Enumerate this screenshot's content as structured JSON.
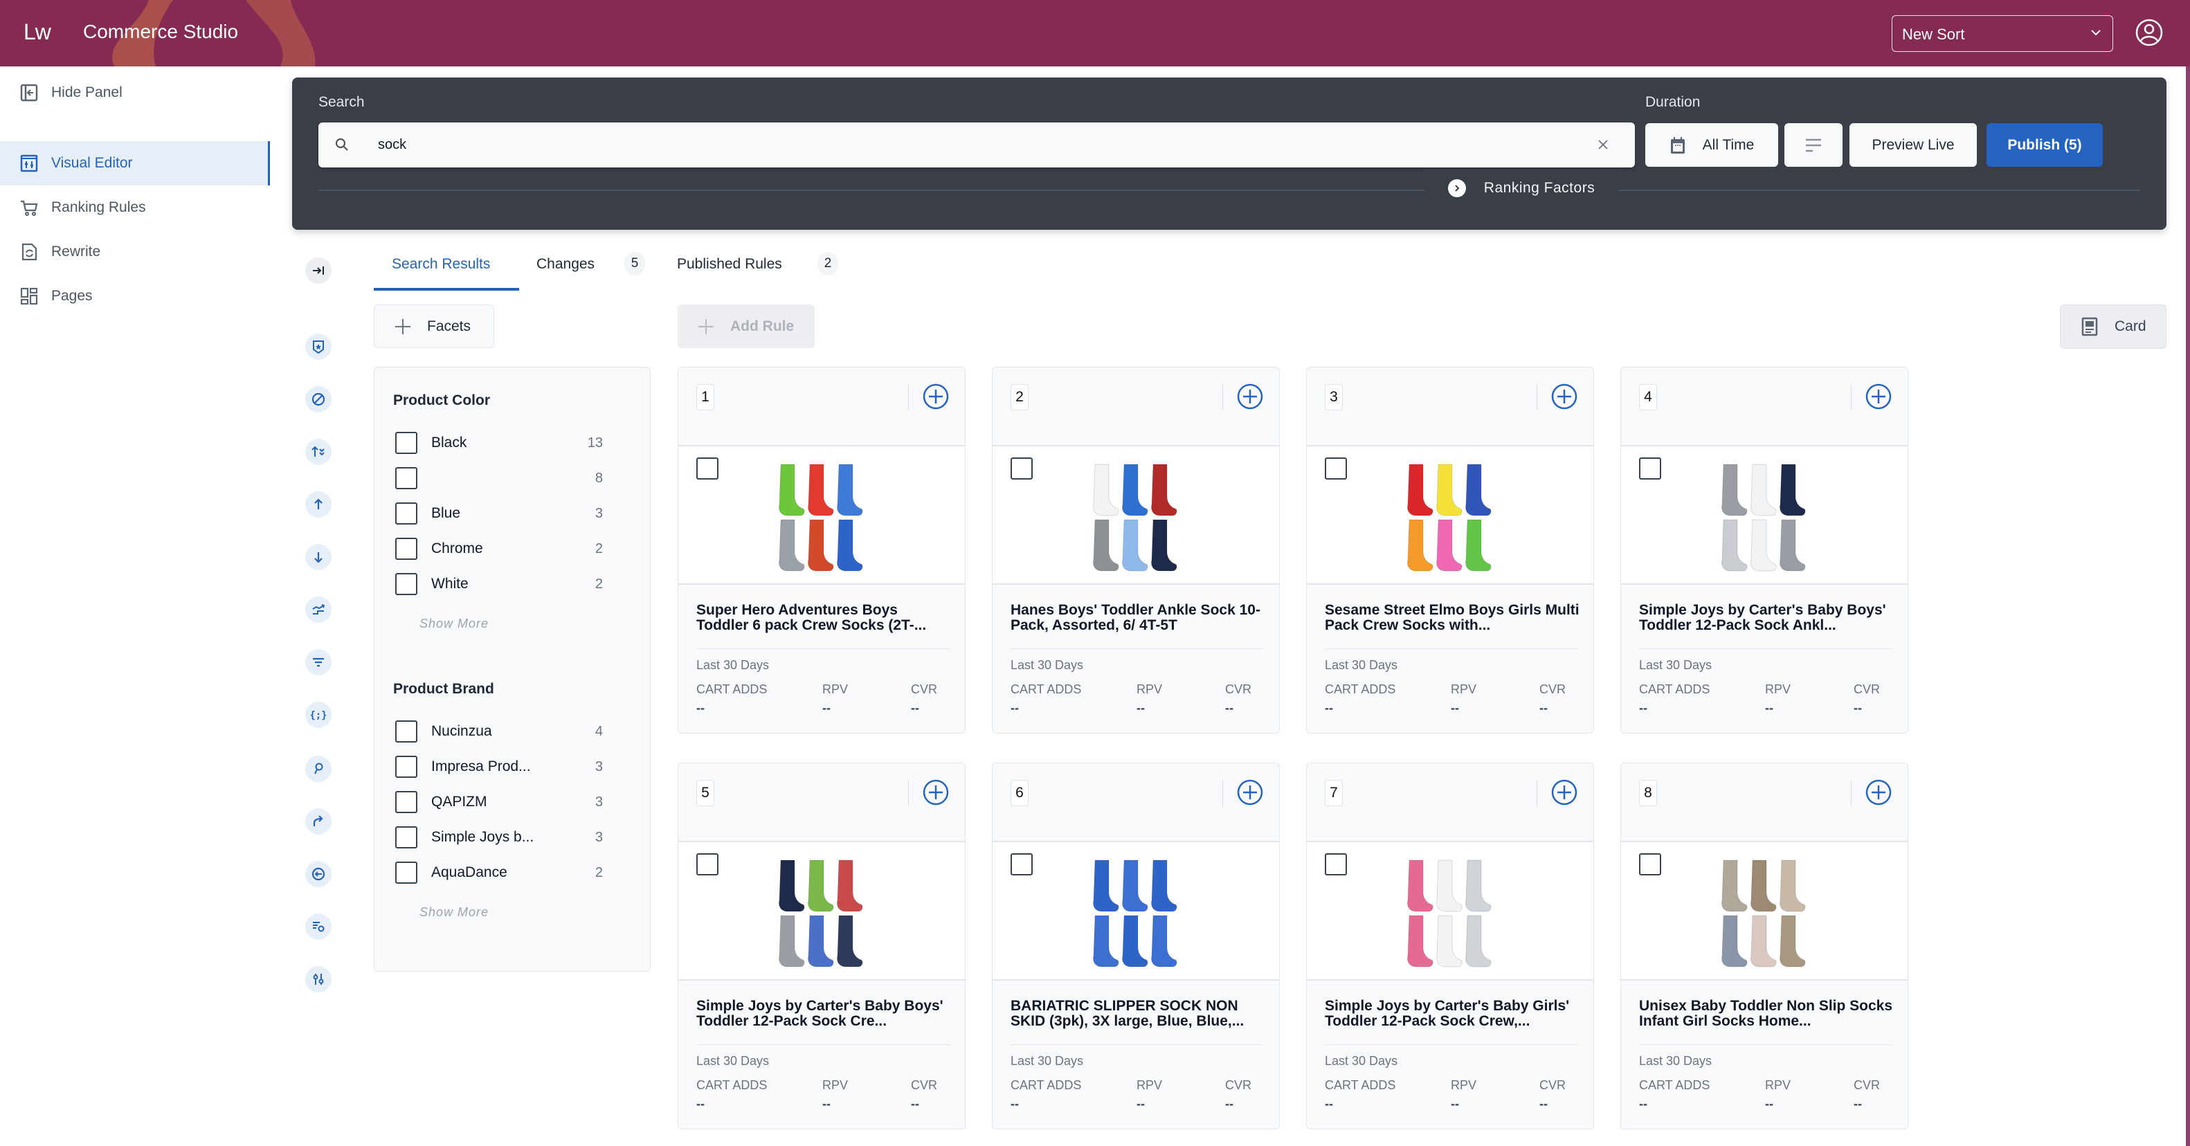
{
  "header": {
    "logo": "Lw",
    "app_title": "Commerce Studio",
    "sort_select": "New Sort"
  },
  "nav": {
    "hide_panel": "Hide Panel",
    "items": [
      {
        "label": "Visual Editor",
        "icon": "visual-editor-icon",
        "active": true
      },
      {
        "label": "Ranking Rules",
        "icon": "cart-icon"
      },
      {
        "label": "Rewrite",
        "icon": "rewrite-icon"
      },
      {
        "label": "Pages",
        "icon": "pages-icon"
      }
    ]
  },
  "rail_icons": [
    "collapse-icon",
    "pin-badge-icon",
    "block-icon",
    "sort-up-check-icon",
    "boost-up-icon",
    "bury-down-icon",
    "swap-icon",
    "filter-icon",
    "code-icon",
    "search-key-icon",
    "redirect-icon",
    "back-circle-icon",
    "list-settings-icon",
    "sliders-icon"
  ],
  "search": {
    "label": "Search",
    "value": "sock",
    "duration_label": "Duration",
    "duration_value": "All Time",
    "preview_live": "Preview Live",
    "publish": "Publish (5)",
    "ranking_factors": "Ranking Factors"
  },
  "tabs": [
    {
      "label": "Search Results",
      "active": true
    },
    {
      "label": "Changes",
      "badge": "5"
    },
    {
      "label": "Published Rules",
      "badge": "2"
    }
  ],
  "toolbar": {
    "facets": "Facets",
    "add_rule": "Add Rule",
    "view_mode": "Card"
  },
  "facets": [
    {
      "title": "Product Color",
      "options": [
        {
          "label": "Black",
          "count": "13"
        },
        {
          "label": "",
          "count": "8"
        },
        {
          "label": "Blue",
          "count": "3"
        },
        {
          "label": "Chrome",
          "count": "2"
        },
        {
          "label": "White",
          "count": "2"
        }
      ],
      "show_more": "Show More"
    },
    {
      "title": "Product Brand",
      "options": [
        {
          "label": "Nucinzua",
          "count": "4"
        },
        {
          "label": "Impresa Prod...",
          "count": "3"
        },
        {
          "label": "QAPIZM",
          "count": "3"
        },
        {
          "label": "Simple Joys b...",
          "count": "3"
        },
        {
          "label": "AquaDance",
          "count": "2"
        }
      ],
      "show_more": "Show More"
    }
  ],
  "metrics_labels": {
    "period": "Last 30 Days",
    "cart_adds": "CART ADDS",
    "rpv": "RPV",
    "cvr": "CVR"
  },
  "products": [
    {
      "rank": "1",
      "title": "Super Hero Adventures Boys Toddler 6 pack Crew Socks (2T-...",
      "cart_adds": "--",
      "rpv": "--",
      "cvr": "--",
      "colors": [
        "#6cc83a",
        "#e33a2f",
        "#3f7bd6",
        "#9aa0a8",
        "#d24a2a",
        "#2e63c8"
      ]
    },
    {
      "rank": "2",
      "title": "Hanes Boys' Toddler Ankle Sock 10-Pack, Assorted, 6/ 4T-5T",
      "cart_adds": "--",
      "rpv": "--",
      "cvr": "--",
      "colors": [
        "#f2f3f5",
        "#2f6fd0",
        "#b02a2a",
        "#8d9095",
        "#8fb8ea",
        "#1e2a4a"
      ]
    },
    {
      "rank": "3",
      "title": "Sesame Street Elmo Boys Girls Multi Pack Crew Socks with...",
      "cart_adds": "--",
      "rpv": "--",
      "cvr": "--",
      "colors": [
        "#d8262a",
        "#f4e23a",
        "#2f56b8",
        "#f39a2a",
        "#ee68b4",
        "#62c548"
      ]
    },
    {
      "rank": "4",
      "title": "Simple Joys by Carter's Baby Boys' Toddler 12-Pack Sock Ankl...",
      "cart_adds": "--",
      "rpv": "--",
      "cvr": "--",
      "colors": [
        "#9a9ea4",
        "#f2f3f5",
        "#1e2a4a",
        "#c9ccd1",
        "#f2f3f5",
        "#9a9ea4"
      ]
    },
    {
      "rank": "5",
      "title": "Simple Joys by Carter's Baby Boys' Toddler 12-Pack Sock Cre...",
      "cart_adds": "--",
      "rpv": "--",
      "cvr": "--",
      "colors": [
        "#1e2a4a",
        "#7bb84a",
        "#c94a4a",
        "#9a9ea4",
        "#4a70c8",
        "#2e3a5a"
      ]
    },
    {
      "rank": "6",
      "title": "BARIATRIC SLIPPER SOCK NON SKID (3pk), 3X large, Blue, Blue,...",
      "cart_adds": "--",
      "rpv": "--",
      "cvr": "--",
      "colors": [
        "#2e64c8",
        "#3b6fd2",
        "#2e64c8",
        "#3b6fd2",
        "#2e64c8",
        "#3b6fd2"
      ]
    },
    {
      "rank": "7",
      "title": "Simple Joys by Carter's Baby Girls' Toddler 12-Pack Sock Crew,...",
      "cart_adds": "--",
      "rpv": "--",
      "cvr": "--",
      "colors": [
        "#e56a93",
        "#f2f3f5",
        "#d0d3d8",
        "#e56a93",
        "#f2f3f5",
        "#d0d3d8"
      ]
    },
    {
      "rank": "8",
      "title": "Unisex Baby Toddler Non Slip Socks Infant Girl Socks Home...",
      "cart_adds": "--",
      "rpv": "--",
      "cvr": "--",
      "colors": [
        "#b0a898",
        "#9c8a72",
        "#c8b8a8",
        "#8a96a8",
        "#d8c8c0",
        "#a89880"
      ]
    }
  ],
  "colors": {
    "brand": "#852a53",
    "accent": "#2563c0",
    "panel_dark": "#3a3e46"
  }
}
